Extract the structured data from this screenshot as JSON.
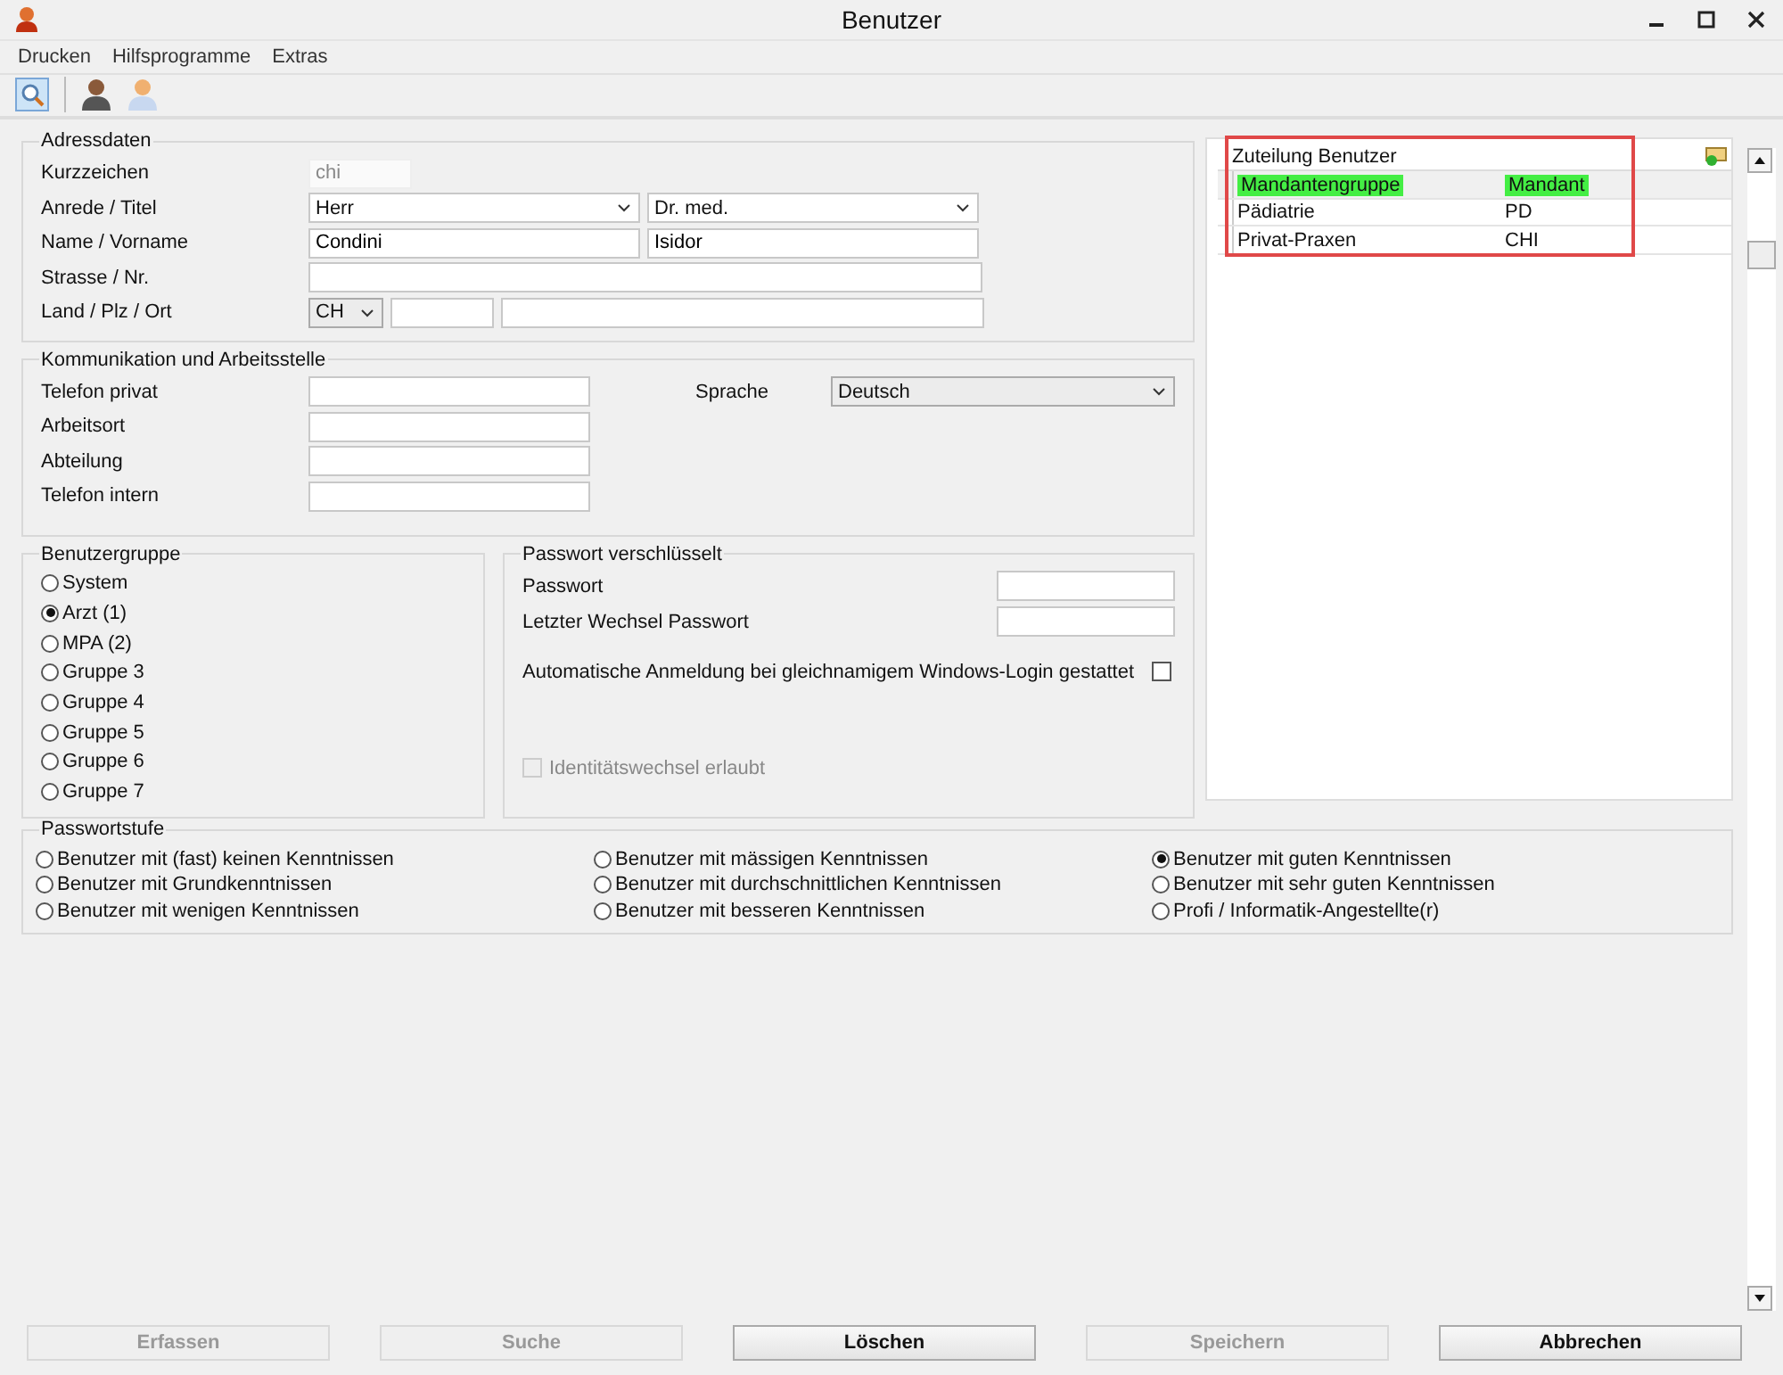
{
  "window": {
    "title": "Benutzer"
  },
  "menu": [
    "Drucken",
    "Hilfsprogramme",
    "Extras"
  ],
  "address": {
    "title": "Adressdaten",
    "short": {
      "label": "Kurzzeichen",
      "value": "chi"
    },
    "salutation": {
      "label": "Anrede / Titel",
      "value": "Herr",
      "title": "Dr. med."
    },
    "name": {
      "label": "Name / Vorname",
      "last": "Condini",
      "first": "Isidor"
    },
    "street": {
      "label": "Strasse / Nr."
    },
    "place": {
      "label": "Land / Plz / Ort",
      "country": "CH"
    }
  },
  "communication": {
    "title": "Kommunikation und Arbeitsstelle",
    "fields": [
      "Telefon privat",
      "Arbeitsort",
      "Abteilung",
      "Telefon intern"
    ],
    "language": {
      "label": "Sprache",
      "value": "Deutsch"
    }
  },
  "user_group": {
    "title": "Benutzergruppe",
    "options": [
      {
        "label": "System",
        "selected": false
      },
      {
        "label": "Arzt (1)",
        "selected": true
      },
      {
        "label": "MPA (2)",
        "selected": false
      },
      {
        "label": "Gruppe 3",
        "selected": false
      },
      {
        "label": "Gruppe 4",
        "selected": false
      },
      {
        "label": "Gruppe 5",
        "selected": false
      },
      {
        "label": "Gruppe 6",
        "selected": false
      },
      {
        "label": "Gruppe 7",
        "selected": false
      }
    ]
  },
  "password": {
    "title": "Passwort verschlüsselt",
    "fields": [
      "Passwort",
      "Letzter Wechsel Passwort"
    ],
    "auto_login": {
      "label": "Automatische Anmeldung bei gleichnamigem Windows-Login gestattet",
      "checked": false
    },
    "identity_switch": {
      "label": "Identitätswechsel erlaubt",
      "checked": false,
      "disabled": true
    }
  },
  "password_level": {
    "title": "Passwortstufe",
    "options": [
      {
        "label": "Benutzer mit (fast) keinen Kenntnissen",
        "selected": false
      },
      {
        "label": "Benutzer mit Grundkenntnissen",
        "selected": false
      },
      {
        "label": "Benutzer mit wenigen Kenntnissen",
        "selected": false
      },
      {
        "label": "Benutzer mit mässigen Kenntnissen",
        "selected": false
      },
      {
        "label": "Benutzer mit durchschnittlichen Kenntnissen",
        "selected": false
      },
      {
        "label": "Benutzer mit besseren Kenntnissen",
        "selected": false
      },
      {
        "label": "Benutzer mit guten Kenntnissen",
        "selected": true
      },
      {
        "label": "Benutzer mit sehr guten Kenntnissen",
        "selected": false
      },
      {
        "label": "Profi / Informatik-Angestellte(r)",
        "selected": false
      }
    ]
  },
  "assignment": {
    "title": "Zuteilung Benutzer",
    "columns": [
      "Mandantengruppe",
      "Mandant"
    ],
    "rows": [
      [
        "Pädiatrie",
        "PD"
      ],
      [
        "Privat-Praxen",
        "CHI"
      ]
    ]
  },
  "buttons": [
    {
      "label": "Erfassen",
      "disabled": true
    },
    {
      "label": "Suche",
      "disabled": true
    },
    {
      "label": "Löschen",
      "disabled": false
    },
    {
      "label": "Speichern",
      "disabled": true
    },
    {
      "label": "Abbrechen",
      "disabled": false
    }
  ]
}
